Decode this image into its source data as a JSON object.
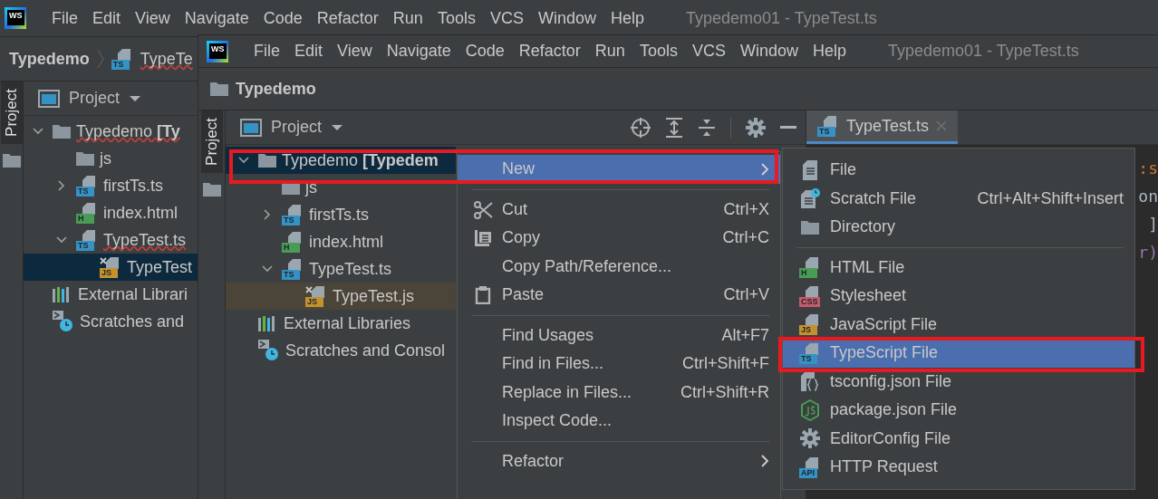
{
  "back_window": {
    "logo": "WS",
    "menu": [
      "File",
      "Edit",
      "View",
      "Navigate",
      "Code",
      "Refactor",
      "Run",
      "Tools",
      "VCS",
      "Window",
      "Help"
    ],
    "title": "Typedemo01 - TypeTest.ts",
    "breadcrumb": [
      {
        "label": "Typedemo",
        "kind": "project",
        "error": false
      },
      {
        "label": "TypeTe",
        "kind": "ts",
        "badge": "TS",
        "error": true
      }
    ],
    "side_tab": {
      "label": "Project",
      "selected": true
    },
    "panel_title": "Project",
    "tree": [
      {
        "label": "Typedemo **[Ty**",
        "kind": "folder",
        "expanded": true,
        "selected": false,
        "error": true,
        "children": [
          {
            "label": "js",
            "kind": "folder",
            "selected": false
          },
          {
            "label": "firstTs.ts",
            "kind": "ts",
            "badge": "TS",
            "expanded": false,
            "selected": false
          },
          {
            "label": "index.html",
            "kind": "html",
            "badge": "H",
            "selected": false
          },
          {
            "label": "TypeTest.ts",
            "kind": "ts",
            "badge": "TS",
            "expanded": true,
            "selected": false,
            "error": true,
            "children": [
              {
                "label": "TypeTest",
                "kind": "jsgen",
                "badge": "JS",
                "selected": true
              }
            ]
          }
        ]
      },
      {
        "label": "External Librari",
        "kind": "libraries",
        "selected": false
      },
      {
        "label": "Scratches and",
        "kind": "scratches",
        "selected": false
      }
    ]
  },
  "front_window": {
    "logo": "WS",
    "menu": [
      "File",
      "Edit",
      "View",
      "Navigate",
      "Code",
      "Refactor",
      "Run",
      "Tools",
      "VCS",
      "Window",
      "Help"
    ],
    "title": "Typedemo01 - TypeTest.ts",
    "breadcrumb": [
      {
        "label": "Typedemo",
        "kind": "folder",
        "error": false
      }
    ],
    "side_tab": {
      "label": "Project",
      "selected": true
    },
    "panel_title": "Project",
    "tree": [
      {
        "label": "Typedemo **[Typedem**",
        "kind": "folder",
        "expanded": true,
        "selected": true,
        "children": [
          {
            "label": "js",
            "kind": "folder",
            "selected": false
          },
          {
            "label": "firstTs.ts",
            "kind": "ts",
            "badge": "TS",
            "expanded": false,
            "selected": false
          },
          {
            "label": "index.html",
            "kind": "html",
            "badge": "H",
            "selected": false
          },
          {
            "label": "TypeTest.ts",
            "kind": "ts",
            "badge": "TS",
            "expanded": true,
            "selected": false,
            "children": [
              {
                "label": "TypeTest.js",
                "kind": "jsgen",
                "badge": "JS",
                "selected": false,
                "highlighted": true
              }
            ]
          }
        ]
      },
      {
        "label": "External Libraries",
        "kind": "libraries",
        "selected": false
      },
      {
        "label": "Scratches and Consol",
        "kind": "scratches",
        "selected": false
      }
    ],
    "editor_tabs": [
      {
        "label": "TypeTest.ts",
        "kind": "ts",
        "badge": "TS",
        "selected": true
      }
    ],
    "code_fragments": [
      {
        "text": ":s",
        "kind": "keyword"
      },
      {
        "text": "on",
        "kind": "plain"
      },
      {
        "text": "]",
        "kind": "plain"
      },
      {
        "text": "r)",
        "kind": "param"
      }
    ],
    "context_menu": {
      "groups": [
        [
          {
            "label": "New",
            "kind": "plain",
            "selected": true,
            "submenu": true,
            "outlined": true
          }
        ],
        [
          {
            "label": "Cut",
            "kind": "scissors",
            "shortcut": "Ctrl+X",
            "selected": false
          },
          {
            "label": "Copy",
            "kind": "copy",
            "shortcut": "Ctrl+C",
            "selected": false
          },
          {
            "label": "Copy Path/Reference...",
            "kind": "plain",
            "selected": false
          },
          {
            "label": "Paste",
            "kind": "paste",
            "shortcut": "Ctrl+V",
            "selected": false
          }
        ],
        [
          {
            "label": "Find Usages",
            "kind": "plain",
            "shortcut": "Alt+F7",
            "selected": false
          },
          {
            "label": "Find in Files...",
            "kind": "plain",
            "shortcut": "Ctrl+Shift+F",
            "selected": false
          },
          {
            "label": "Replace in Files...",
            "kind": "plain",
            "shortcut": "Ctrl+Shift+R",
            "selected": false
          },
          {
            "label": "Inspect Code...",
            "kind": "plain",
            "selected": false
          }
        ],
        [
          {
            "label": "Refactor",
            "kind": "plain",
            "submenu": true,
            "selected": false
          }
        ]
      ]
    },
    "submenu": {
      "groups": [
        [
          {
            "label": "File",
            "kind": "file",
            "selected": false
          },
          {
            "label": "Scratch File",
            "kind": "scratch",
            "shortcut": "Ctrl+Alt+Shift+Insert",
            "selected": false
          },
          {
            "label": "Directory",
            "kind": "folder",
            "selected": false
          }
        ],
        [
          {
            "label": "HTML File",
            "kind": "html",
            "badge": "H",
            "selected": false
          },
          {
            "label": "Stylesheet",
            "kind": "css",
            "badge": "CSS",
            "selected": false
          },
          {
            "label": "JavaScript File",
            "kind": "js",
            "badge": "JS",
            "selected": false
          },
          {
            "label": "TypeScript File",
            "kind": "ts",
            "badge": "TS",
            "selected": true,
            "outlined": true
          },
          {
            "label": "tsconfig.json File",
            "kind": "tsconfig",
            "selected": false
          },
          {
            "label": "package.json File",
            "kind": "node",
            "selected": false
          },
          {
            "label": "EditorConfig File",
            "kind": "gear",
            "selected": false
          },
          {
            "label": "HTTP Request",
            "kind": "api",
            "badge": "API",
            "selected": false
          }
        ]
      ]
    }
  }
}
